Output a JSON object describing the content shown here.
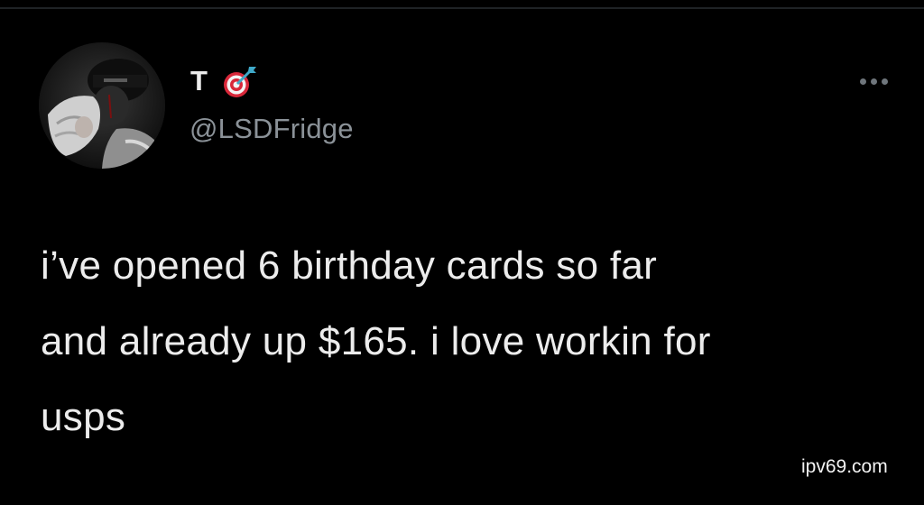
{
  "tweet": {
    "author": {
      "display_name": "T",
      "display_name_emoji": "direct-hit-dart-icon",
      "handle": "@LSDFridge",
      "avatar": "avatar"
    },
    "more_menu_icon": "more-dots-icon",
    "text_lines": [
      "i’ve opened 6 birthday cards so far",
      "and already up $165. i love workin for",
      "usps"
    ]
  },
  "watermark": "ipv69.com",
  "colors": {
    "background": "#000000",
    "primary_text": "#ececec",
    "secondary_text": "#8b9298",
    "icon_gray": "#6f767c",
    "dart_red": "#d8283a",
    "dart_cyan": "#3fa9c9"
  }
}
